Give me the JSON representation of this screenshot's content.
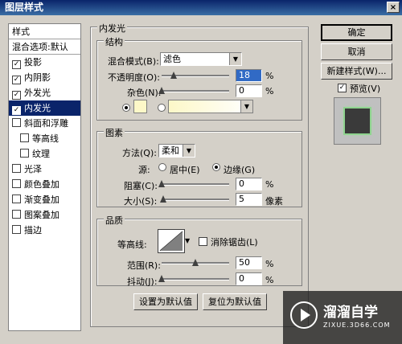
{
  "window": {
    "title": "图层样式",
    "close": "×"
  },
  "left_panel": {
    "items": [
      {
        "label": "样式",
        "checkbox": false,
        "checked": false,
        "selected": false,
        "head": true
      },
      {
        "label": "混合选项:默认",
        "checkbox": false,
        "checked": false,
        "selected": false,
        "head": true
      },
      {
        "label": "投影",
        "checkbox": true,
        "checked": true,
        "selected": false
      },
      {
        "label": "内阴影",
        "checkbox": true,
        "checked": true,
        "selected": false
      },
      {
        "label": "外发光",
        "checkbox": true,
        "checked": true,
        "selected": false
      },
      {
        "label": "内发光",
        "checkbox": true,
        "checked": true,
        "selected": true
      },
      {
        "label": "斜面和浮雕",
        "checkbox": true,
        "checked": false,
        "selected": false
      },
      {
        "label": "等高线",
        "checkbox": true,
        "checked": false,
        "selected": false,
        "indent": true
      },
      {
        "label": "纹理",
        "checkbox": true,
        "checked": false,
        "selected": false,
        "indent": true
      },
      {
        "label": "光泽",
        "checkbox": true,
        "checked": false,
        "selected": false
      },
      {
        "label": "颜色叠加",
        "checkbox": true,
        "checked": false,
        "selected": false
      },
      {
        "label": "渐变叠加",
        "checkbox": true,
        "checked": false,
        "selected": false
      },
      {
        "label": "图案叠加",
        "checkbox": true,
        "checked": false,
        "selected": false
      },
      {
        "label": "描边",
        "checkbox": true,
        "checked": false,
        "selected": false
      }
    ]
  },
  "inner_glow": {
    "title": "内发光",
    "structure": {
      "legend": "结构",
      "blend_mode_label": "混合模式(B):",
      "blend_mode_value": "滤色",
      "opacity_label": "不透明度(O):",
      "opacity_value": "18",
      "opacity_level": 18,
      "noise_label": "杂色(N):",
      "noise_value": "0",
      "noise_level": 0,
      "pct": "%",
      "glow_color": "#fdf8c8"
    },
    "elements": {
      "legend": "图素",
      "method_label": "方法(Q):",
      "method_value": "柔和",
      "source_label": "源:",
      "source_center": "居中(E)",
      "source_edge": "边缘(G)",
      "choke_label": "阻塞(C):",
      "choke_value": "0",
      "choke_level": 0,
      "size_label": "大小(S):",
      "size_value": "5",
      "size_level": 2,
      "size_unit": "像素",
      "pct": "%"
    },
    "quality": {
      "legend": "品质",
      "contour_label": "等高线:",
      "antialias_label": "消除锯齿(L)",
      "range_label": "范围(R):",
      "range_value": "50",
      "range_level": 50,
      "jitter_label": "抖动(J):",
      "jitter_value": "0",
      "jitter_level": 0,
      "pct": "%"
    },
    "make_default": "设置为默认值",
    "reset_default": "复位为默认值"
  },
  "right_buttons": {
    "ok": "确定",
    "cancel": "取消",
    "new_style": "新建样式(W)...",
    "preview_label": "预览(V)"
  },
  "watermark": {
    "brand": "溜溜自学",
    "url": "ZIXUE.3D66.COM"
  }
}
